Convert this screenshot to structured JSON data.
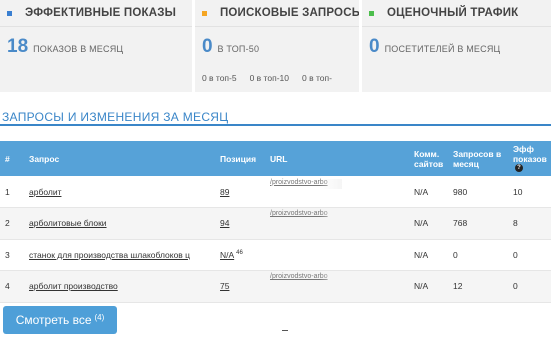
{
  "stats": [
    {
      "title": "ЭФФЕКТИВНЫЕ ПОКАЗЫ",
      "color": "#3a7fd1",
      "value": "18",
      "unit": "ПОКАЗОВ В МЕСЯЦ",
      "tops": []
    },
    {
      "title": "ПОИСКОВЫЕ ЗАПРОСЫ",
      "color": "#f5a623",
      "value": "0",
      "unit": "В ТОП-50",
      "tops": [
        "0 в топ-5",
        "0 в топ-10",
        "0 в топ-"
      ]
    },
    {
      "title": "ОЦЕНОЧНЫЙ ТРАФИК",
      "color": "#4cbe4c",
      "value": "0",
      "unit": "ПОСЕТИТЕЛЕЙ В МЕСЯЦ",
      "tops": []
    }
  ],
  "section": {
    "title": "ЗАПРОСЫ И ИЗМЕНЕНИЯ ЗА МЕСЯЦ"
  },
  "table": {
    "headers": {
      "num": "#",
      "query": "Запрос",
      "position": "Позиция",
      "url": "URL",
      "comm": "Комм. сайтов",
      "requests": "Запросов в месяц",
      "eff": "Эфф показов"
    },
    "rows": [
      {
        "num": "1",
        "query": "арболит",
        "position": "89",
        "position_note": "",
        "url": "/proizvodstvo-arbo",
        "comm": "N/A",
        "requests": "980",
        "eff": "10"
      },
      {
        "num": "2",
        "query": "арболитовые блоки",
        "position": "94",
        "position_note": "",
        "url": "/proizvodstvo-arbo",
        "comm": "N/A",
        "requests": "768",
        "eff": "8"
      },
      {
        "num": "3",
        "query": "станок для производства шлакоблоков ц",
        "position": "N/A",
        "position_note": "46",
        "url": "",
        "comm": "N/A",
        "requests": "0",
        "eff": "0"
      },
      {
        "num": "4",
        "query": "арболит производство",
        "position": "75",
        "position_note": "",
        "url": "/proizvodstvo-arbo",
        "comm": "N/A",
        "requests": "12",
        "eff": "0"
      }
    ]
  },
  "button": {
    "label": "Смотреть все",
    "count": "(4)"
  }
}
